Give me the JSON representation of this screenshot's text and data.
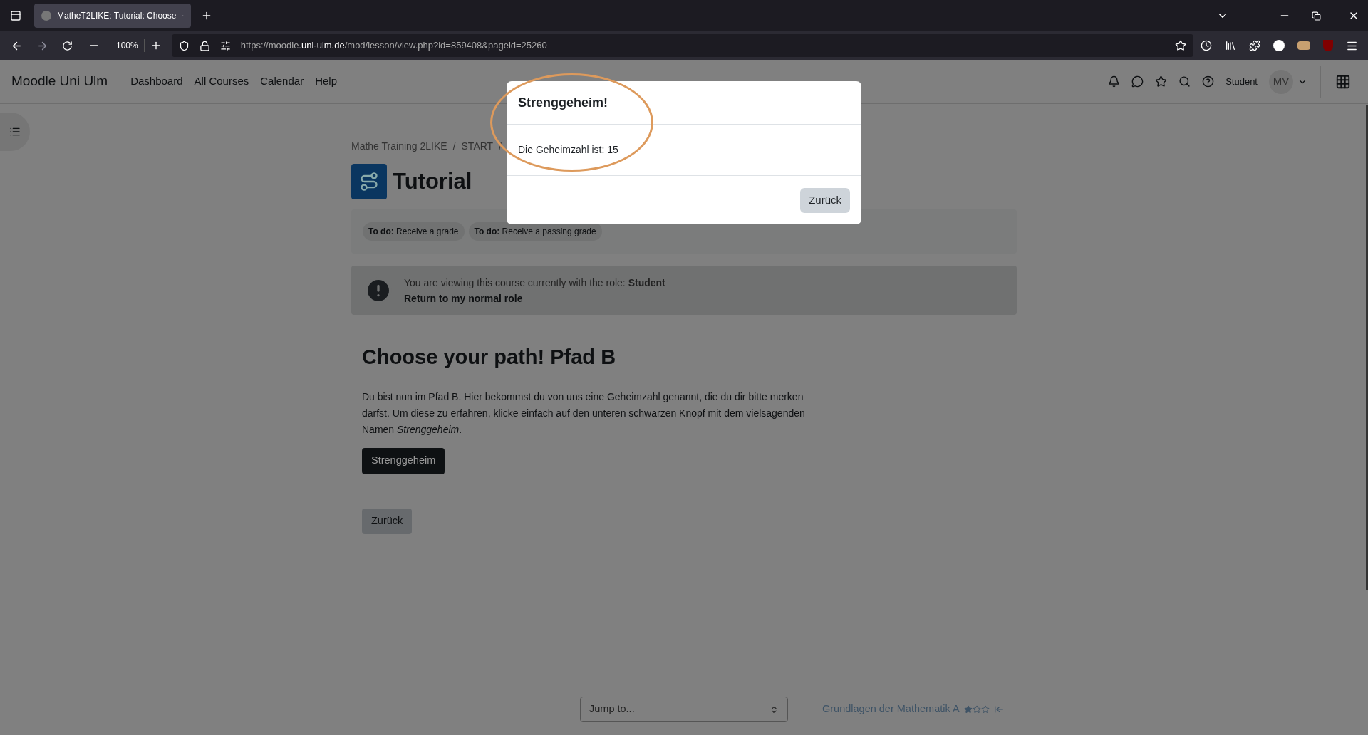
{
  "browser": {
    "tab_title": "MatheT2LIKE: Tutorial: Choose",
    "zoom": "100%",
    "url_prefix": "https://moodle.",
    "url_domain": "uni-ulm.de",
    "url_path": "/mod/lesson/view.php?id=859408&pageid=25260"
  },
  "site": {
    "name": "Moodle Uni Ulm",
    "nav": [
      "Dashboard",
      "All Courses",
      "Calendar",
      "Help"
    ],
    "role": "Student",
    "initials": "MV"
  },
  "breadcrumb": {
    "items": [
      "Mathe Training 2LIKE",
      "START"
    ],
    "separator": "/"
  },
  "activity": {
    "title": "Tutorial",
    "completion": [
      "**To do:** Receive a grade",
      "**To do:** Receive a passing grade"
    ]
  },
  "notice": {
    "text": "You are viewing this course currently with the role: **Student**",
    "link": "Return to my normal role"
  },
  "lesson": {
    "heading": "Choose your path! Pfad B",
    "text": "Du bist nun im Pfad B. Hier bekommst du von uns eine Geheimzahl genannt, die du dir bitte merken darfst. Um diese zu erfahren, klicke einfach auf den unteren schwarzen Knopf mit dem vielsagenden Namen *Strenggeheim*.",
    "primary_button": "Strenggeheim",
    "back_button": "Zurück"
  },
  "footer": {
    "jump_placeholder": "Jump to...",
    "next_link": "Grundlagen der Mathematik A",
    "stars": 1
  },
  "modal": {
    "title": "Strenggeheim!",
    "body": "Die Geheimzahl ist: 15",
    "button": "Zurück",
    "highlighted": true
  }
}
